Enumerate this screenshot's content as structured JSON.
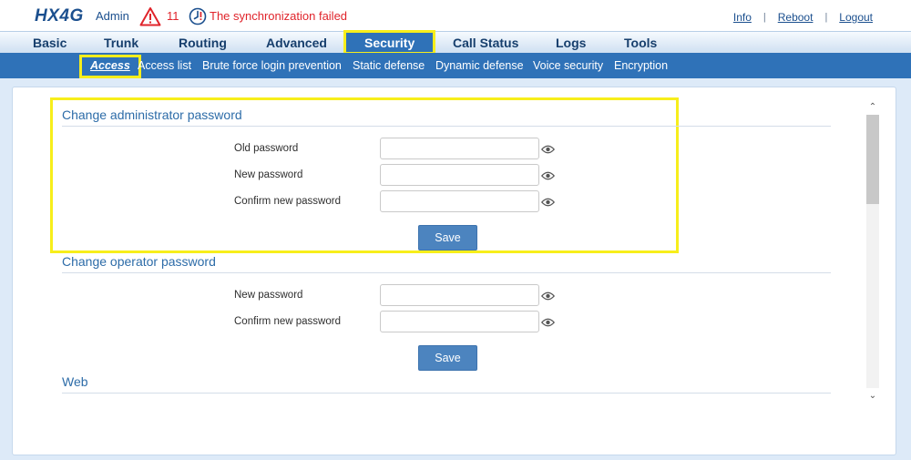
{
  "header": {
    "logo": "HX4G",
    "user": "Admin",
    "alarm_count": "11",
    "sync_status": "The synchronization failed",
    "links": {
      "info": "Info",
      "reboot": "Reboot",
      "logout": "Logout"
    }
  },
  "main_nav": {
    "basic": "Basic",
    "trunk": "Trunk",
    "routing": "Routing",
    "advanced": "Advanced",
    "security": "Security",
    "call_status": "Call Status",
    "logs": "Logs",
    "tools": "Tools",
    "active": "Security"
  },
  "sub_nav": {
    "access": "Access",
    "access_list": "Access list",
    "brute_force": "Brute force login prevention",
    "static_defense": "Static defense",
    "dynamic_defense": "Dynamic defense",
    "voice_security": "Voice security",
    "encryption": "Encryption",
    "active": "Access"
  },
  "admin_section": {
    "title": "Change administrator password",
    "old_password_label": "Old password",
    "new_password_label": "New password",
    "confirm_password_label": "Confirm new password",
    "old_password_value": "",
    "new_password_value": "",
    "confirm_password_value": "",
    "save_label": "Save"
  },
  "operator_section": {
    "title": "Change operator password",
    "new_password_label": "New password",
    "confirm_password_label": "Confirm new password",
    "new_password_value": "",
    "confirm_password_value": "",
    "save_label": "Save"
  },
  "web_section": {
    "title": "Web"
  },
  "colors": {
    "brand_blue": "#2f72b8",
    "highlight": "#f7ee1b",
    "alert_red": "#e0242b",
    "button_blue": "#4c84bf"
  },
  "icons": {
    "alarm": "warning-triangle-icon",
    "sync": "clock-alert-icon",
    "show_password": "eye-icon"
  }
}
